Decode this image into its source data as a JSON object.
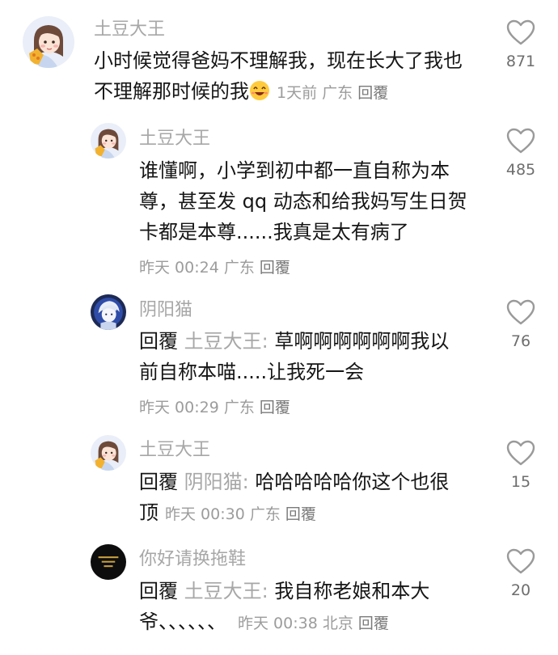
{
  "comments": [
    {
      "name": "土豆大王",
      "lines": [
        "小时候觉得爸妈不理解我，现在长大了我也",
        "不理解那时候的我"
      ],
      "meta": {
        "time": "1天前",
        "location": "广东",
        "reply": "回覆"
      },
      "likes": "871",
      "emoji": "laughing-face-icon"
    },
    {
      "name": "土豆大王",
      "lines": [
        "谁懂啊，小学到初中都一直自称为本",
        "尊，甚至发 qq 动态和给我妈写生日贺",
        "卡都是本尊......我真是太有病了"
      ],
      "meta": {
        "time": "昨天 00:24",
        "location": "广东",
        "reply": "回覆"
      },
      "likes": "485"
    },
    {
      "name": "阴阳猫",
      "reply_prefix": "回覆",
      "mention": "土豆大王:",
      "lines": [
        "草啊啊啊啊啊啊我以",
        "前自称本喵.....让我死一会"
      ],
      "meta": {
        "time": "昨天 00:29",
        "location": "广东",
        "reply": "回覆"
      },
      "likes": "76"
    },
    {
      "name": "土豆大王",
      "reply_prefix": "回覆",
      "mention": "阴阳猫:",
      "lines": [
        "哈哈哈哈哈你这个也很",
        "顶"
      ],
      "meta": {
        "time": "昨天 00:30",
        "location": "广东",
        "reply": "回覆"
      },
      "likes": "15"
    },
    {
      "name": "你好请换拖鞋",
      "reply_prefix": "回覆",
      "mention": "土豆大王:",
      "lines": [
        "我自称老娘和本大",
        "爷、、、、、、"
      ],
      "meta": {
        "time": "昨天 00:38",
        "location": "北京",
        "reply": "回覆"
      },
      "likes": "20"
    }
  ],
  "colors": {
    "text": "#161616",
    "secondary": "#a7a7a7",
    "meta": "#9c9c9c"
  }
}
